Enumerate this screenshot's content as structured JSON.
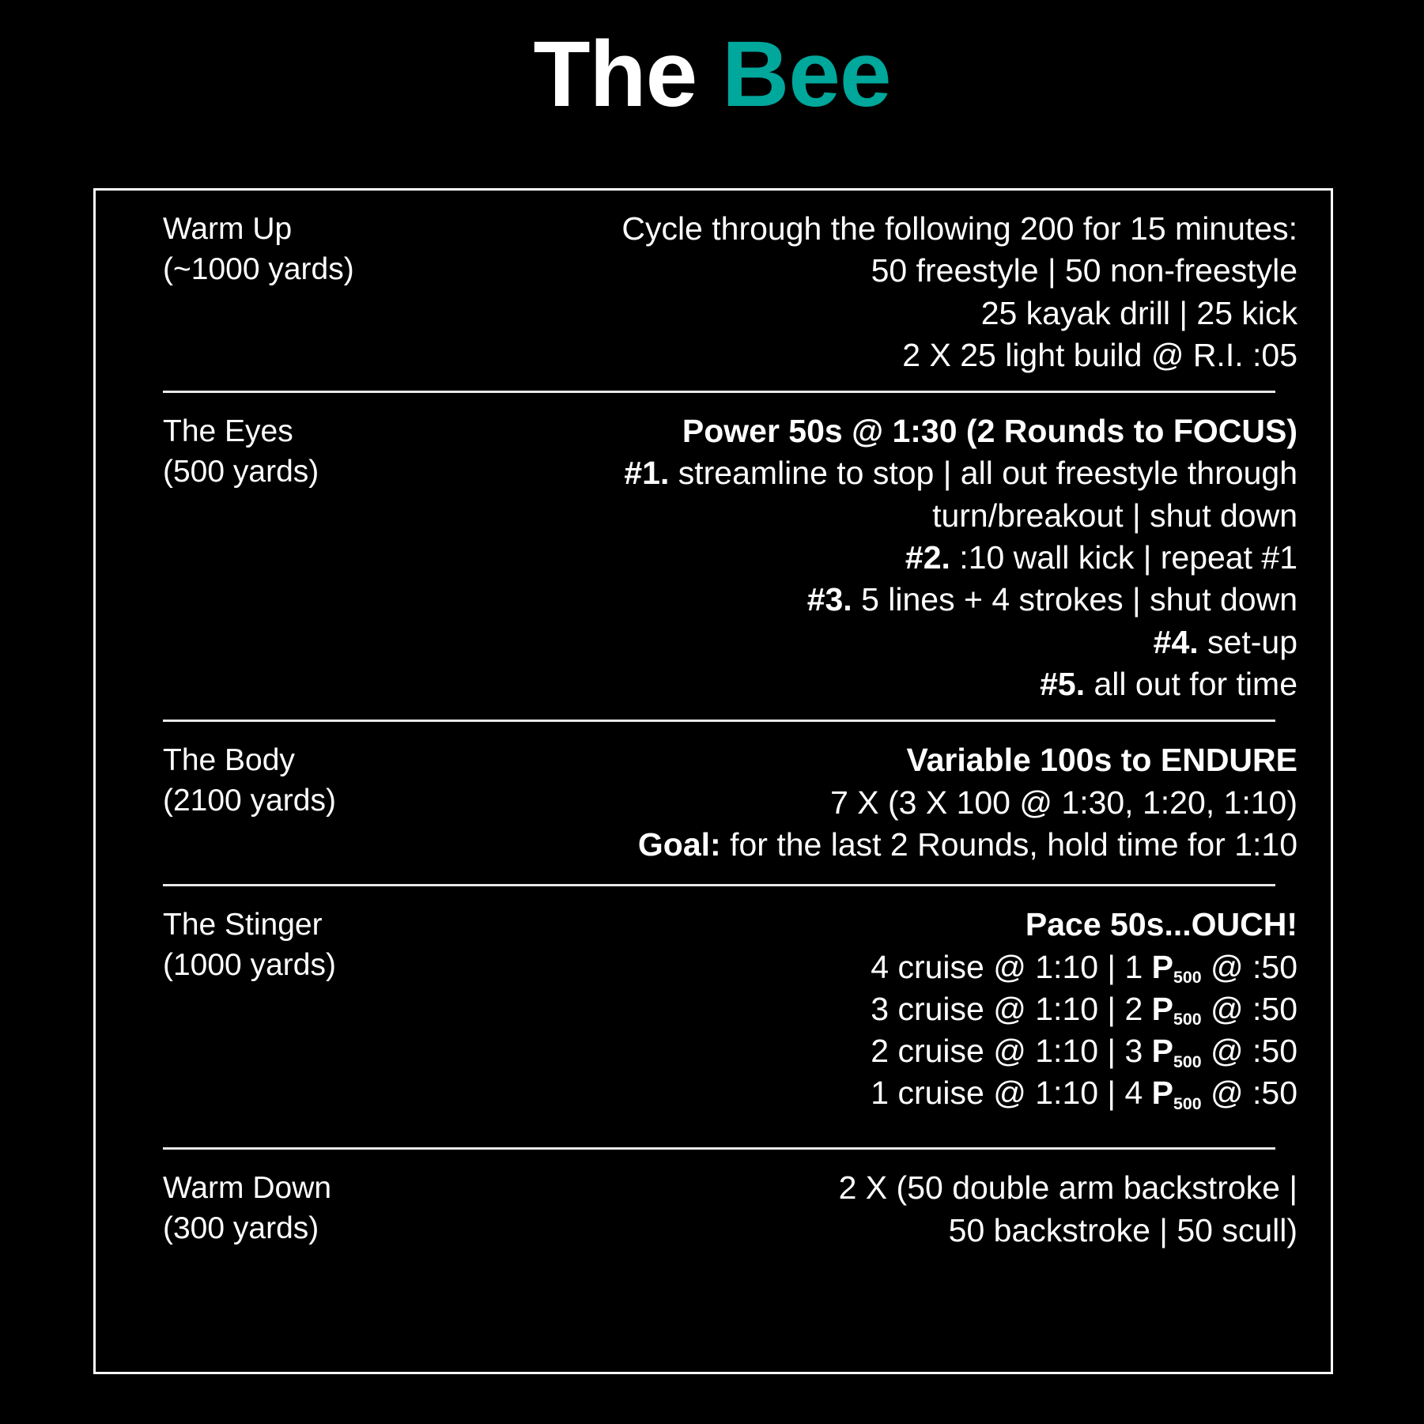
{
  "title": {
    "part1": "The ",
    "part2": "Bee",
    "accent_color": "#00a79b",
    "base_color": "#ffffff"
  },
  "background_color": "#000000",
  "sections": [
    {
      "name": "Warm Up",
      "yards": "(~1000 yards)",
      "header": "",
      "lines": [
        "Cycle through the following 200 for 15 minutes:",
        "50 freestyle | 50 non-freestyle",
        "25 kayak drill | 25 kick",
        "2 X 25 light build @ R.I. :05"
      ]
    },
    {
      "name": "The Eyes",
      "yards": "(500 yards)",
      "header": "Power 50s @ 1:30 (2 Rounds to FOCUS)",
      "items": [
        {
          "num": "#1.",
          "text": " streamline to stop | all out freestyle through turn/breakout | shut down"
        },
        {
          "num": "#2.",
          "text": " :10 wall kick | repeat #1"
        },
        {
          "num": "#3.",
          "text": " 5 lines + 4 strokes | shut down"
        },
        {
          "num": "#4.",
          "text": " set-up"
        },
        {
          "num": "#5.",
          "text": " all out for time"
        }
      ]
    },
    {
      "name": "The Body",
      "yards": "(2100 yards)",
      "header": "Variable 100s to ENDURE",
      "lines": [
        "7 X (3 X 100 @ 1:30, 1:20, 1:10)"
      ],
      "goal_label": "Goal:",
      "goal_text": " for the last 2 Rounds, hold time for 1:10"
    },
    {
      "name": "The Stinger",
      "yards": "(1000 yards)",
      "header": "Pace 50s...OUCH!",
      "rows": [
        {
          "pre": "4 cruise @ 1:10 | 1 ",
          "p": "P",
          "sub": "500",
          "post": " @ :50"
        },
        {
          "pre": "3 cruise @ 1:10 | 2 ",
          "p": "P",
          "sub": "500",
          "post": " @ :50"
        },
        {
          "pre": "2 cruise @ 1:10 | 3 ",
          "p": "P",
          "sub": "500",
          "post": " @ :50"
        },
        {
          "pre": "1 cruise @ 1:10 | 4 ",
          "p": "P",
          "sub": "500",
          "post": " @ :50"
        }
      ]
    },
    {
      "name": "Warm Down",
      "yards": "(300 yards)",
      "header": "",
      "lines": [
        "2  X (50 double arm backstroke |",
        "50 backstroke | 50 scull)"
      ]
    }
  ]
}
